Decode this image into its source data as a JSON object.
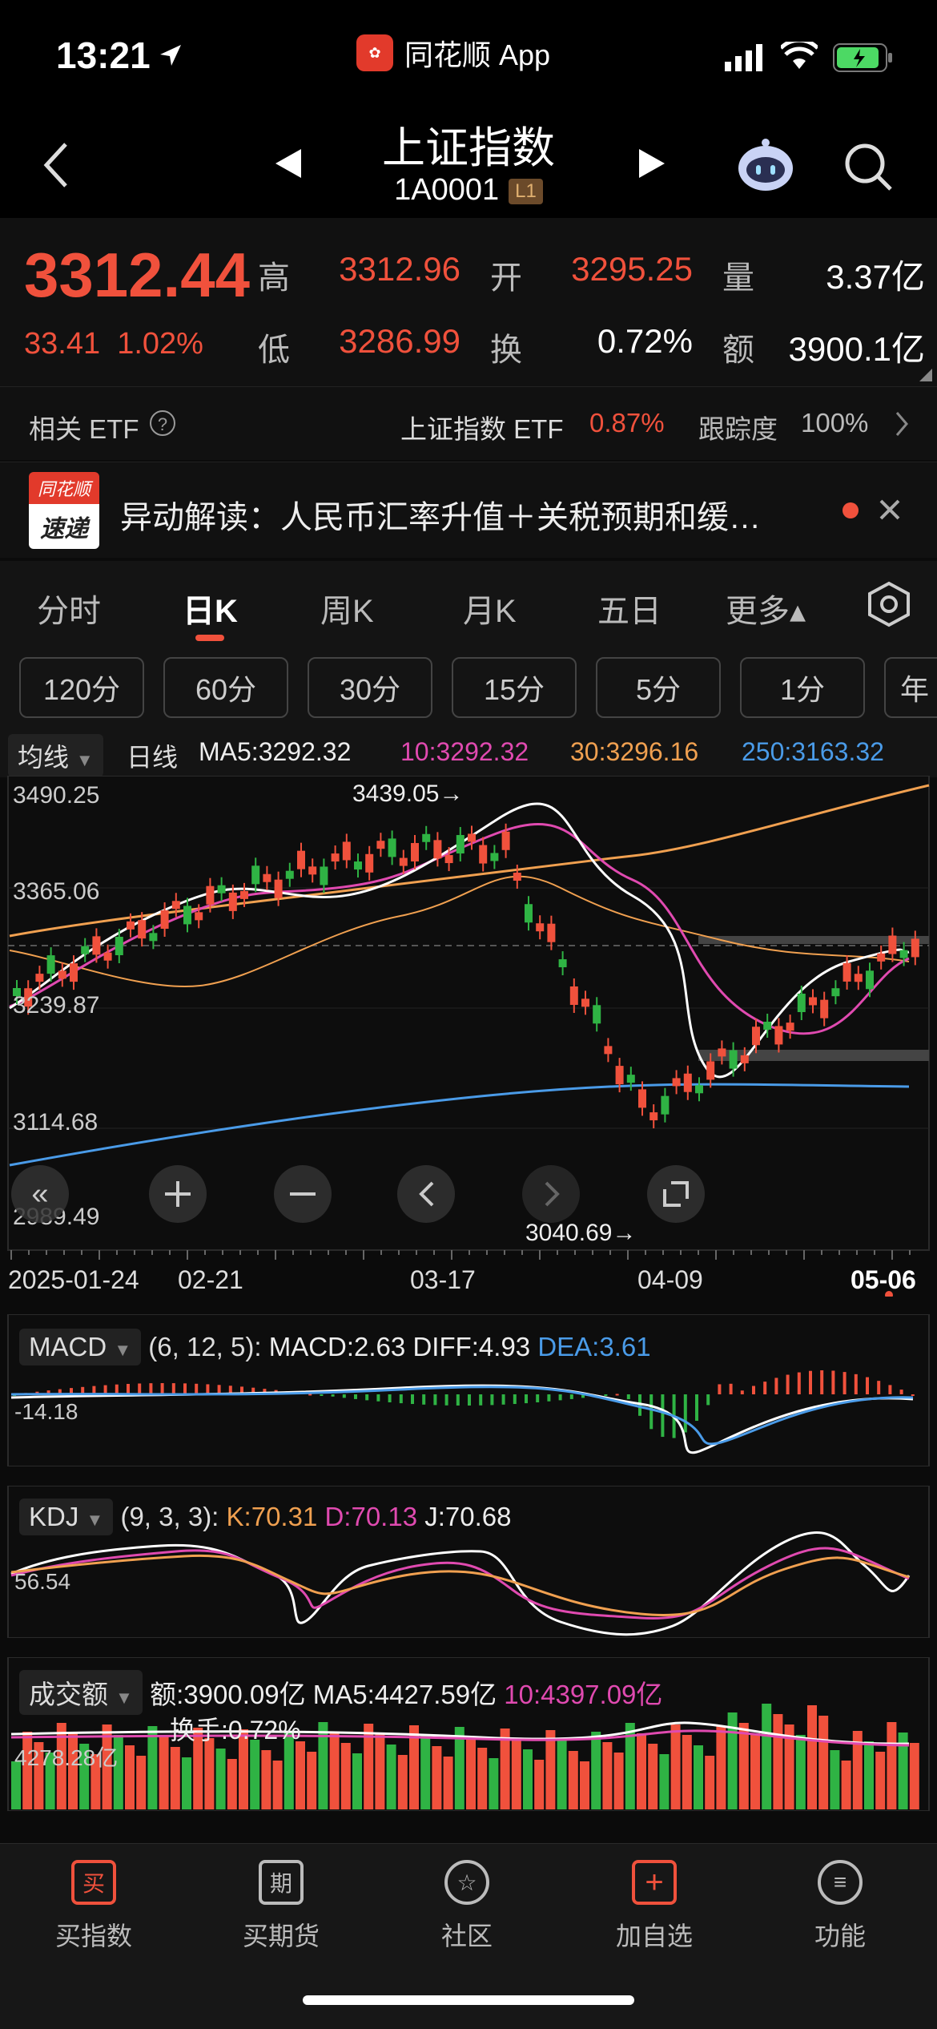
{
  "status_bar": {
    "time": "13:21",
    "app_name": "同花顺 App"
  },
  "header": {
    "title": "上证指数",
    "code": "1A0001",
    "level": "L1"
  },
  "quote": {
    "price": "3312.44",
    "change": "33.41",
    "change_pct": "1.02%",
    "high_label": "高",
    "high": "3312.96",
    "open_label": "开",
    "open": "3295.25",
    "vol_label": "量",
    "vol": "3.37亿",
    "low_label": "低",
    "low": "3286.99",
    "turn_label": "换",
    "turn": "0.72%",
    "amount_label": "额",
    "amount": "3900.1亿"
  },
  "etf": {
    "label": "相关 ETF",
    "name": "上证指数 ETF",
    "pct": "0.87%",
    "track_label": "跟踪度",
    "track": "100%"
  },
  "news": {
    "badge_top": "同花顺",
    "badge_bottom": "速递",
    "text": "异动解读：人民币汇率升值＋关税预期和缓…"
  },
  "tabs": [
    "分时",
    "日K",
    "周K",
    "月K",
    "五日",
    "更多▴"
  ],
  "periods": [
    "120分",
    "60分",
    "30分",
    "15分",
    "5分",
    "1分",
    "年"
  ],
  "ma_row": {
    "dropdown": "均线",
    "type": "日线",
    "ma5": "MA5:3292.32",
    "ma10": "10:3292.32",
    "ma30": "30:3296.16",
    "ma250": "250:3163.32"
  },
  "kline": {
    "y_labels": [
      "3490.25",
      "3365.06",
      "3239.87",
      "3114.68",
      "2989.49"
    ],
    "high_mark": "3439.05→",
    "low_mark": "3040.69→",
    "x_labels": [
      "2025-01-24",
      "02-21",
      "03-17",
      "04-09",
      "05-06"
    ]
  },
  "macd": {
    "dropdown": "MACD",
    "params": "(6, 12, 5):",
    "macd": "MACD:2.63",
    "diff": "DIFF:4.93",
    "dea": "DEA:3.61",
    "axis": "-14.18"
  },
  "kdj": {
    "dropdown": "KDJ",
    "params": "(9, 3, 3):",
    "k": "K:70.31",
    "d": "D:70.13",
    "j": "J:70.68",
    "axis": "56.54"
  },
  "volume": {
    "dropdown": "成交额",
    "amount": "额:3900.09亿",
    "ma5": "MA5:4427.59亿",
    "ma10": "10:4397.09亿",
    "turnover": "换手:0.72%",
    "axis": "4278.28亿"
  },
  "bottom_nav": [
    {
      "icon": "买",
      "label": "买指数"
    },
    {
      "icon": "期",
      "label": "买期货"
    },
    {
      "icon": "☆",
      "label": "社区"
    },
    {
      "icon": "+",
      "label": "加自选"
    },
    {
      "icon": "≡",
      "label": "功能"
    }
  ],
  "colors": {
    "up": "#f0513c",
    "down": "#2fb344",
    "ma5": "#ffffff",
    "ma10": "#e04ab0",
    "ma30": "#f0a050",
    "ma250": "#4a9be8"
  }
}
